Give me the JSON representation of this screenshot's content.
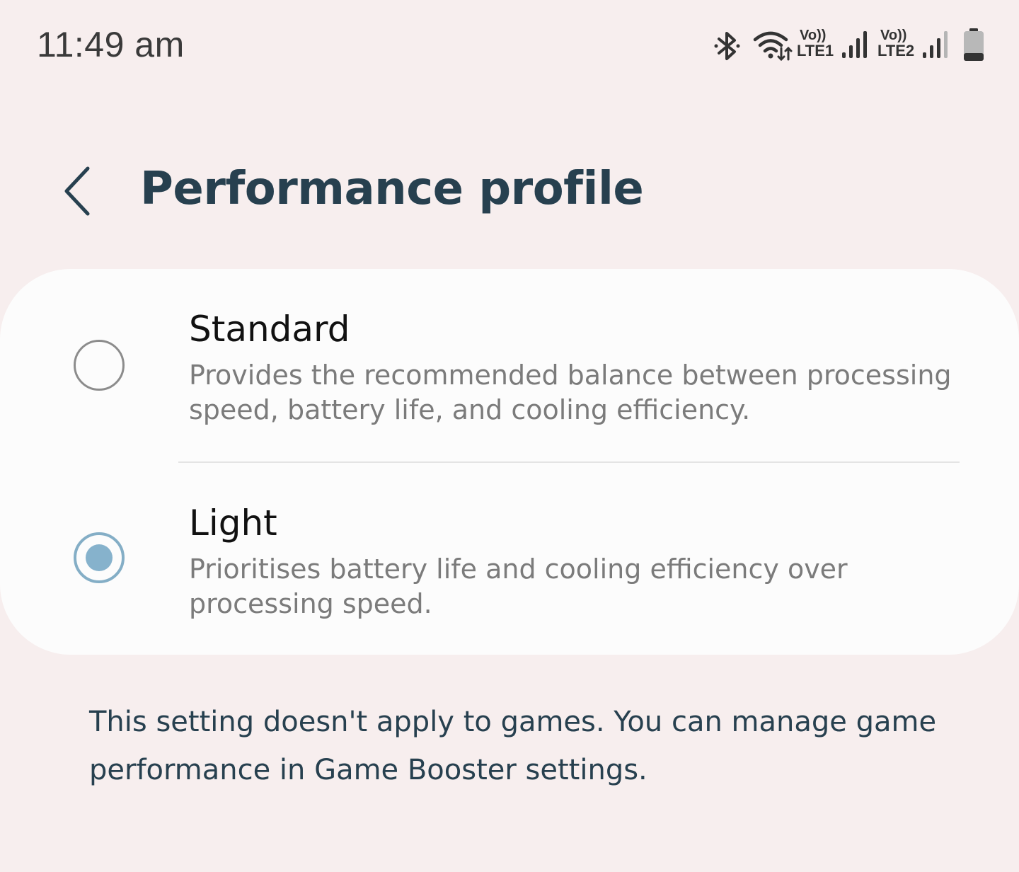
{
  "status_bar": {
    "time": "11:49 am",
    "icons": [
      "bluetooth-icon",
      "wifi-icon",
      "volte-lte1-icon",
      "signal-1-icon",
      "volte-lte2-icon",
      "signal-2-icon",
      "battery-icon"
    ],
    "sim1_top": "Vo))",
    "sim1_bottom": "LTE1",
    "sim2_top": "Vo))",
    "sim2_bottom": "LTE2"
  },
  "header": {
    "title": "Performance profile"
  },
  "options": [
    {
      "title": "Standard",
      "description": "Provides the recommended balance between processing speed, battery life, and cooling efficiency.",
      "selected": false
    },
    {
      "title": "Light",
      "description": "Prioritises battery life and cooling efficiency over processing speed.",
      "selected": true
    }
  ],
  "footnote": "This setting doesn't apply to games. You can manage game performance in Game Booster settings.",
  "colors": {
    "background": "#f7eeee",
    "card": "#fcfcfc",
    "title": "#27404f",
    "accent": "#86b2cc",
    "secondary_text": "#7b7b7b"
  }
}
